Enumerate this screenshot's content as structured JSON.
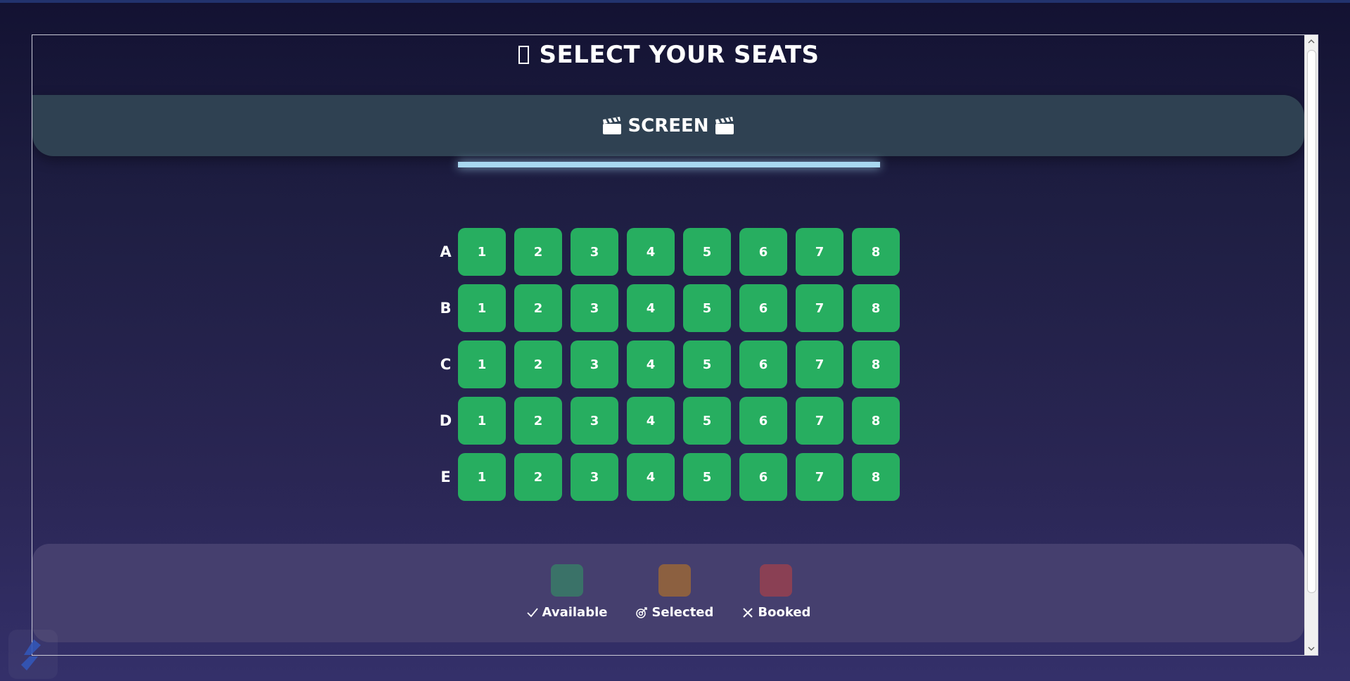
{
  "page": {
    "title": "SELECT YOUR SEATS",
    "screen_label": "SCREEN"
  },
  "seat_map": {
    "rows": [
      {
        "label": "A",
        "seats": [
          "1",
          "2",
          "3",
          "4",
          "5",
          "6",
          "7",
          "8"
        ]
      },
      {
        "label": "B",
        "seats": [
          "1",
          "2",
          "3",
          "4",
          "5",
          "6",
          "7",
          "8"
        ]
      },
      {
        "label": "C",
        "seats": [
          "1",
          "2",
          "3",
          "4",
          "5",
          "6",
          "7",
          "8"
        ]
      },
      {
        "label": "D",
        "seats": [
          "1",
          "2",
          "3",
          "4",
          "5",
          "6",
          "7",
          "8"
        ]
      },
      {
        "label": "E",
        "seats": [
          "1",
          "2",
          "3",
          "4",
          "5",
          "6",
          "7",
          "8"
        ]
      }
    ],
    "seat_status": "available"
  },
  "legend": {
    "items": [
      {
        "label": "Available",
        "icon": "check-icon",
        "color": "#3a7268"
      },
      {
        "label": "Selected",
        "icon": "target-icon",
        "color": "#8c6040"
      },
      {
        "label": "Booked",
        "icon": "close-icon",
        "color": "#8a4054"
      }
    ]
  },
  "colors": {
    "available_seat": "#27ae60",
    "screen_glow": "#a8d8f0",
    "screen_bar": "#2f4152",
    "legend_panel": "#453f6e"
  },
  "icons": {
    "title_icon": "missing-glyph-icon",
    "screen_icon": "clapperboard-icon",
    "corner_logo": "app-logo-icon"
  }
}
